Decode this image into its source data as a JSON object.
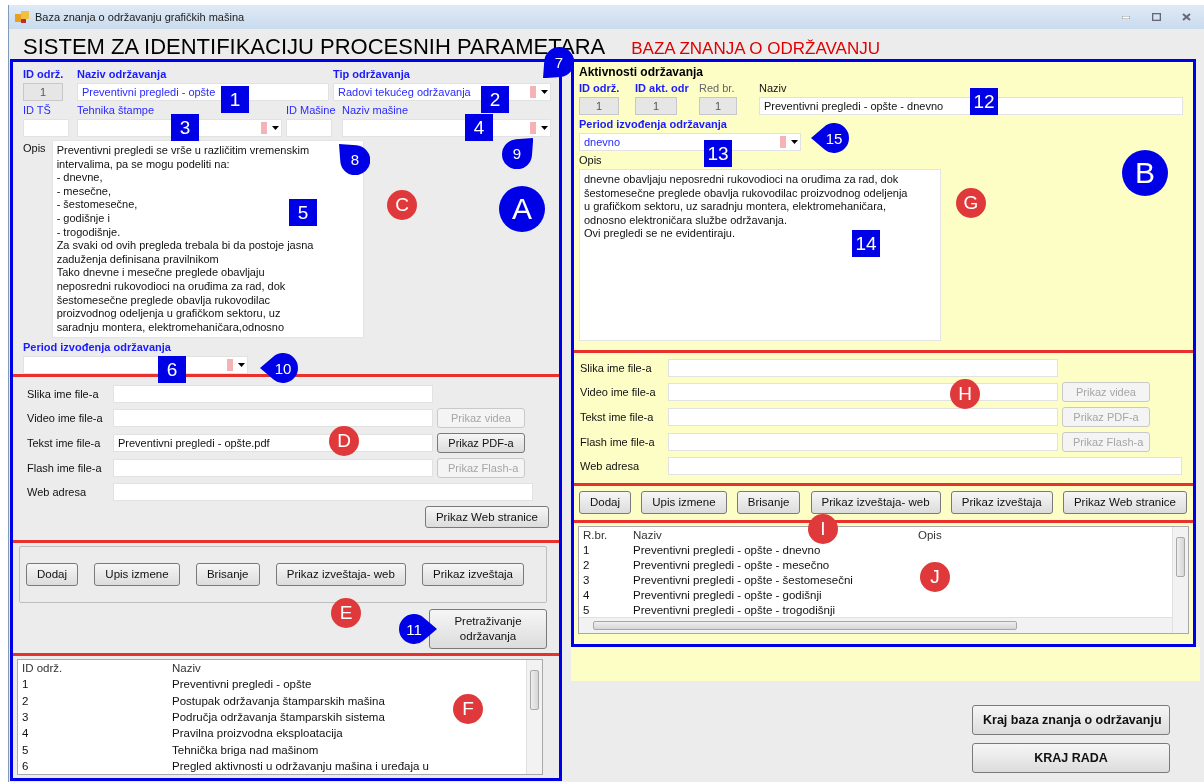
{
  "window": {
    "title": "Baza znanja o održavanju grafičkih mašina"
  },
  "header": {
    "title": "SISTEM ZA IDENTIFIKACIJU PROCESNIH PARAMETARA",
    "subtitle": "BAZA ZNANJA O ODRŽAVANJU"
  },
  "maintenance": {
    "markers": [
      {
        "kind": "circle",
        "label": "A"
      }
    ],
    "details": {
      "markers": [
        {
          "kind": "dot",
          "label": "C"
        }
      ],
      "id": {
        "label": "ID održ.",
        "value": "1",
        "disabled": true
      },
      "name": {
        "label": "Naziv održavanja",
        "value": "Preventivni pregledi - opšte",
        "markers": [
          {
            "kind": "square",
            "label": "1"
          }
        ]
      },
      "type": {
        "label": "Tip održavanja",
        "value": "Radovi tekućeg održavanja",
        "markers": [
          {
            "kind": "square",
            "label": "2"
          },
          {
            "kind": "pin",
            "label": "7"
          }
        ]
      },
      "ts_id": {
        "label": "ID TŠ"
      },
      "technique": {
        "label": "Tehnika štampe",
        "markers": [
          {
            "kind": "square",
            "label": "3"
          },
          {
            "kind": "pin",
            "label": "8"
          }
        ]
      },
      "machine_id": {
        "label": "ID Mašine"
      },
      "machine_name": {
        "label": "Naziv mašine",
        "markers": [
          {
            "kind": "square",
            "label": "4"
          },
          {
            "kind": "pin",
            "label": "9"
          }
        ]
      },
      "description": {
        "label": "Opis",
        "value": "Preventivni pregledi se vrše u različitim vremenskim\nintervalima, pa se mogu podeliti na:\n- dnevne,\n- mesečne,\n- šestomesečne,\n- godišnje i\n- trogodišnje.\nZa svaki od ovih pregleda trebala bi da postoje jasna\nzaduženja definisana pravilnikom\nTako dnevne i mesečne preglede obavljaju\nneposredni rukovodioci na oruđima za rad, dok\nšestomesečne preglede obavlja rukovodilac\nproizvodnog odeljenja u grafičkom sektoru, uz\nsaradnju montera, elektromehaničara,odnosno",
        "markers": [
          {
            "kind": "square",
            "label": "5"
          }
        ]
      },
      "period": {
        "label": "Period izvođenja održavanja",
        "markers": [
          {
            "kind": "square",
            "label": "6"
          },
          {
            "kind": "pin",
            "label": "10"
          }
        ]
      }
    },
    "files": {
      "markers": [
        {
          "kind": "dot",
          "label": "D"
        }
      ],
      "rows": [
        {
          "label": "Slika ime file-a"
        },
        {
          "label": "Video ime file-a",
          "button": {
            "label": "Prikaz videa",
            "disabled": true
          }
        },
        {
          "label": "Tekst ime file-a",
          "value": "Preventivni pregledi - opšte.pdf",
          "button": {
            "label": "Prikaz PDF-a",
            "disabled": false
          }
        },
        {
          "label": "Flash ime file-a",
          "button": {
            "label": "Prikaz Flash-a",
            "disabled": true
          }
        },
        {
          "label": "Web adresa"
        }
      ],
      "web_button": {
        "label": "Prikaz Web stranice",
        "disabled": false
      }
    },
    "actions": {
      "markers": [
        {
          "kind": "dot",
          "label": "E"
        }
      ],
      "buttons": [
        "Dodaj",
        "Upis izmene",
        "Brisanje",
        "Prikaz izveštaja- web",
        "Prikaz izveštaja"
      ],
      "search": {
        "label": "Pretraživanje održavanja",
        "markers": [
          {
            "kind": "pin",
            "label": "11"
          }
        ]
      }
    },
    "list": {
      "markers": [
        {
          "kind": "dot",
          "label": "F"
        }
      ],
      "columns": [
        "ID održ.",
        "Naziv"
      ],
      "rows": [
        [
          "1",
          "Preventivni pregledi - opšte"
        ],
        [
          "2",
          "Postupak održavanja štamparskih mašina"
        ],
        [
          "3",
          "Područja održavanja štamparskih sistema"
        ],
        [
          "4",
          "Pravilna proizvodna eksploatacija"
        ],
        [
          "5",
          "Tehnička briga nad mašinom"
        ],
        [
          "6",
          "Pregled aktivnosti u održavanju mašina i uređaja u"
        ]
      ]
    }
  },
  "activities": {
    "markers": [
      {
        "kind": "circle",
        "label": "B"
      }
    ],
    "title": "Aktivnosti održavanja",
    "details": {
      "markers": [
        {
          "kind": "dot",
          "label": "G"
        }
      ],
      "maintenance_id": {
        "label": "ID održ.",
        "value": "1",
        "disabled": true
      },
      "activity_id": {
        "label": "ID akt. odr",
        "value": "1",
        "disabled": true
      },
      "order": {
        "label": "Red br.",
        "value": "1",
        "disabled": true
      },
      "name": {
        "label": "Naziv",
        "value": "Preventivni pregledi - opšte - dnevno",
        "markers": [
          {
            "kind": "square",
            "label": "12"
          }
        ]
      },
      "period": {
        "label": "Period izvođenja održavanja",
        "value": "dnevno",
        "markers": [
          {
            "kind": "square",
            "label": "13"
          },
          {
            "kind": "pin",
            "label": "15"
          }
        ]
      },
      "description": {
        "label": "Opis",
        "value": "dnevne obavljaju neposredni rukovodioci na oruđima za rad, dok\nšestomesečne preglede obavlja rukovodilac proizvodnog odeljenja\nu grafičkom sektoru, uz saradnju montera, elektromehaničara,\nodnosno elektroničara službe održavanja.\nOvi pregledi se ne evidentiraju.",
        "markers": [
          {
            "kind": "square",
            "label": "14"
          }
        ]
      }
    },
    "files": {
      "markers": [
        {
          "kind": "dot",
          "label": "H"
        }
      ],
      "rows": [
        {
          "label": "Slika ime file-a"
        },
        {
          "label": "Video ime file-a",
          "button": {
            "label": "Prikaz videa",
            "disabled": true
          }
        },
        {
          "label": "Tekst ime file-a",
          "button": {
            "label": "Prikaz PDF-a",
            "disabled": true
          }
        },
        {
          "label": "Flash ime file-a",
          "button": {
            "label": "Prikaz Flash-a",
            "disabled": true
          }
        },
        {
          "label": "Web adresa"
        }
      ]
    },
    "actions": {
      "markers": [
        {
          "kind": "dot",
          "label": "I"
        }
      ],
      "buttons": [
        "Dodaj",
        "Upis izmene",
        "Brisanje",
        "Prikaz izveštaja- web",
        "Prikaz izveštaja",
        "Prikaz Web stranice"
      ]
    },
    "list": {
      "markers": [
        {
          "kind": "dot",
          "label": "J"
        }
      ],
      "columns": [
        "R.br.",
        "Naziv",
        "Opis"
      ],
      "rows": [
        [
          "1",
          "Preventivni pregledi - opšte - dnevno"
        ],
        [
          "2",
          "Preventivni pregledi - opšte - mesečno"
        ],
        [
          "3",
          "Preventivni pregledi - opšte - šestomesečni"
        ],
        [
          "4",
          "Preventivni pregledi - opšte - godišnji"
        ],
        [
          "5",
          "Preventivni pregledi - opšte - trogodišnji"
        ]
      ]
    }
  },
  "footer_buttons": [
    "Kraj baza znanja o održavanju",
    "KRAJ RADA"
  ]
}
